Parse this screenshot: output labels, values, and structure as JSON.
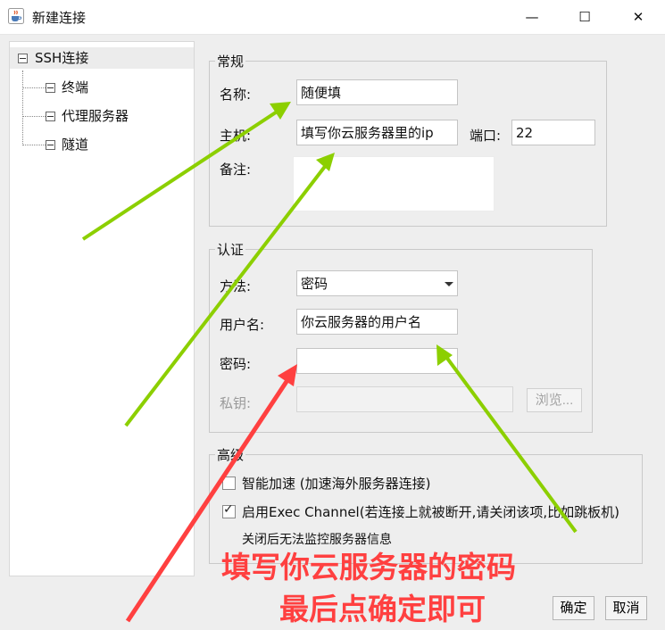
{
  "window": {
    "title": "新建连接",
    "icon": "java-cup-icon",
    "controls": {
      "minimize": "—",
      "maximize": "☐",
      "close": "✕"
    }
  },
  "tree": {
    "root": "SSH连接",
    "children": [
      "终端",
      "代理服务器",
      "隧道"
    ]
  },
  "general": {
    "legend": "常规",
    "name_label": "名称:",
    "name_value": "随便填",
    "host_label": "主机:",
    "host_value": "填写你云服务器里的ip",
    "port_label": "端口:",
    "port_value": "22",
    "note_label": "备注:",
    "note_value": ""
  },
  "auth": {
    "legend": "认证",
    "method_label": "方法:",
    "method_value": "密码",
    "user_label": "用户名:",
    "user_value": "你云服务器的用户名",
    "password_label": "密码:",
    "password_value": "",
    "key_label": "私钥:",
    "key_value": "",
    "browse_label": "浏览..."
  },
  "advanced": {
    "legend": "高级",
    "smart_accel_label": "智能加速 (加速海外服务器连接)",
    "smart_accel_checked": false,
    "exec_channel_label": "启用Exec Channel(若连接上就被断开,请关闭该项,比如跳板机)",
    "exec_channel_checked": true,
    "exec_channel_note": "关闭后无法监控服务器信息"
  },
  "buttons": {
    "ok": "确定",
    "cancel": "取消"
  },
  "annotation": {
    "line1": "填写你云服务器的密码",
    "line2": "最后点确定即可",
    "color_text": "#ff4040",
    "color_green_arrow": "#8ccf00",
    "color_red_arrow": "#ff4040"
  }
}
